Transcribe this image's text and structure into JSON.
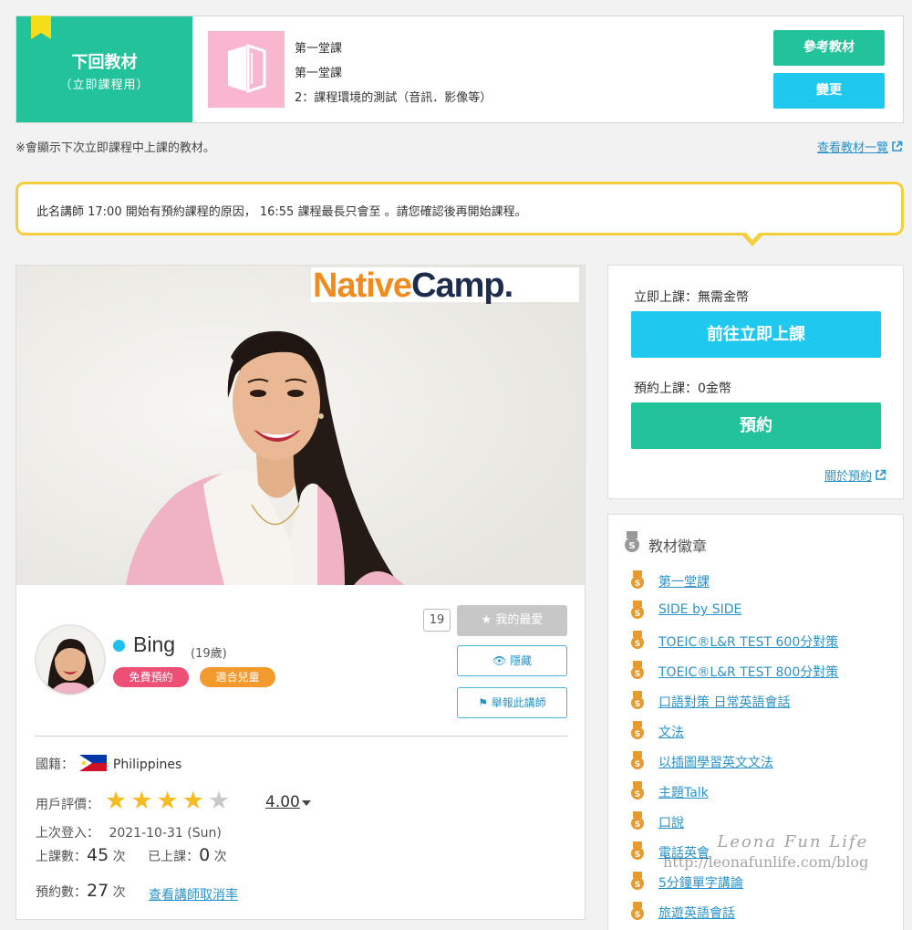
{
  "next_material": {
    "title": "下回教材",
    "subtitle": "（立即課程用）",
    "line1": "第一堂課",
    "line2": "第一堂課",
    "line3": "2：課程環境的測試（音訊．影像等）",
    "reference_button": "參考教材",
    "change_button": "變更"
  },
  "note_text": "※會顯示下次立即課程中上課的教材。",
  "material_list_link": "查看教材一覽",
  "notice_text": "此名講師 17:00 開始有預約課程的原因， 16:55 課程最長只會至 。請您確認後再開始課程。",
  "logo": {
    "part1": "Native",
    "part2": "Camp."
  },
  "teacher": {
    "name": "Bing",
    "age": "(19歲)",
    "tag_free": "免費預約",
    "tag_kids": "適合兒童",
    "favorite_count": "19",
    "favorite_button": "我的最愛",
    "hide_button": "隱藏",
    "report_button": "舉報此講師",
    "nationality_label": "國籍：",
    "nationality": "Philippines",
    "rating_label": "用戶評價：",
    "rating": 4.0,
    "rating_text": "4.00",
    "last_login_label": "上次登入：",
    "last_login": "2021-10-31 (Sun)",
    "lessons_label": "上課數：",
    "lessons": "45",
    "lessons_unit": "次",
    "taken_label": "已上課：",
    "taken": "0",
    "taken_unit": "次",
    "reservations_label": "預約數：",
    "reservations": "27",
    "reservations_unit": "次",
    "cancel_rate_link": "查看講師取消率"
  },
  "booking": {
    "instant_label": "立即上課：無需金幣",
    "instant_button": "前往立即上課",
    "reserve_label": "預約上課：0金幣",
    "reserve_button": "預約",
    "about_link": "關於預約"
  },
  "badges": {
    "title": "教材徽章",
    "items": [
      "第一堂課",
      "SIDE by SIDE",
      "TOEIC®L&R TEST 600分對策",
      "TOEIC®L&R TEST 800分對策",
      "口語對策 日常英語會話",
      "文法",
      "以插圖學習英文文法",
      "主題Talk",
      "口說",
      "電話英會",
      "5分鐘單字講論",
      "旅遊英語會話"
    ]
  },
  "watermark": {
    "line1": "Leona Fun Life",
    "line2": "http://leonafunlife.com/blog"
  },
  "colors": {
    "green": "#22c29a",
    "cyan": "#1ec8ef",
    "link": "#2a93c9",
    "notice_border": "#f4ce3c",
    "star": "#f6bb21"
  }
}
